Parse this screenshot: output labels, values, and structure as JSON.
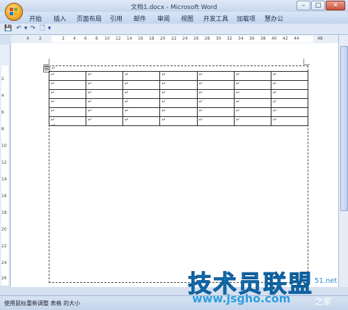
{
  "window": {
    "title": "文档1.docx - Microsoft Word",
    "minimize": "–",
    "maximize": "□",
    "close": "✕"
  },
  "ribbon": {
    "tabs": [
      "开始",
      "插入",
      "页面布局",
      "引用",
      "邮件",
      "审阅",
      "视图",
      "开发工具",
      "加载项",
      "慧办公"
    ]
  },
  "quick_access": {
    "save": "💾",
    "undo": "↶",
    "redo": "↷",
    "preview": "🗋",
    "more": "▾"
  },
  "ruler": {
    "horizontal_numbers": [
      "4",
      "2",
      "2",
      "4",
      "6",
      "8",
      "10",
      "12",
      "14",
      "16",
      "18",
      "20",
      "22",
      "24",
      "26",
      "28",
      "30",
      "32",
      "34",
      "36",
      "38",
      "40",
      "42",
      "44",
      "48"
    ],
    "vertical_numbers": [
      "2",
      "4",
      "6",
      "8",
      "10",
      "12",
      "14",
      "16",
      "18",
      "20",
      "22",
      "24",
      "26"
    ]
  },
  "document": {
    "table": {
      "rows": 6,
      "columns": 7,
      "cell_mark": "↵"
    },
    "paragraph_mark": "↵",
    "move_handle": "⊞"
  },
  "status": {
    "text": "使用鼠标重新调整 表格 的大小"
  },
  "watermark": {
    "main": "技术员联盟",
    "sub": "www.jsgho.com",
    "side_top": "51.net",
    "side_bottom": "之家"
  }
}
